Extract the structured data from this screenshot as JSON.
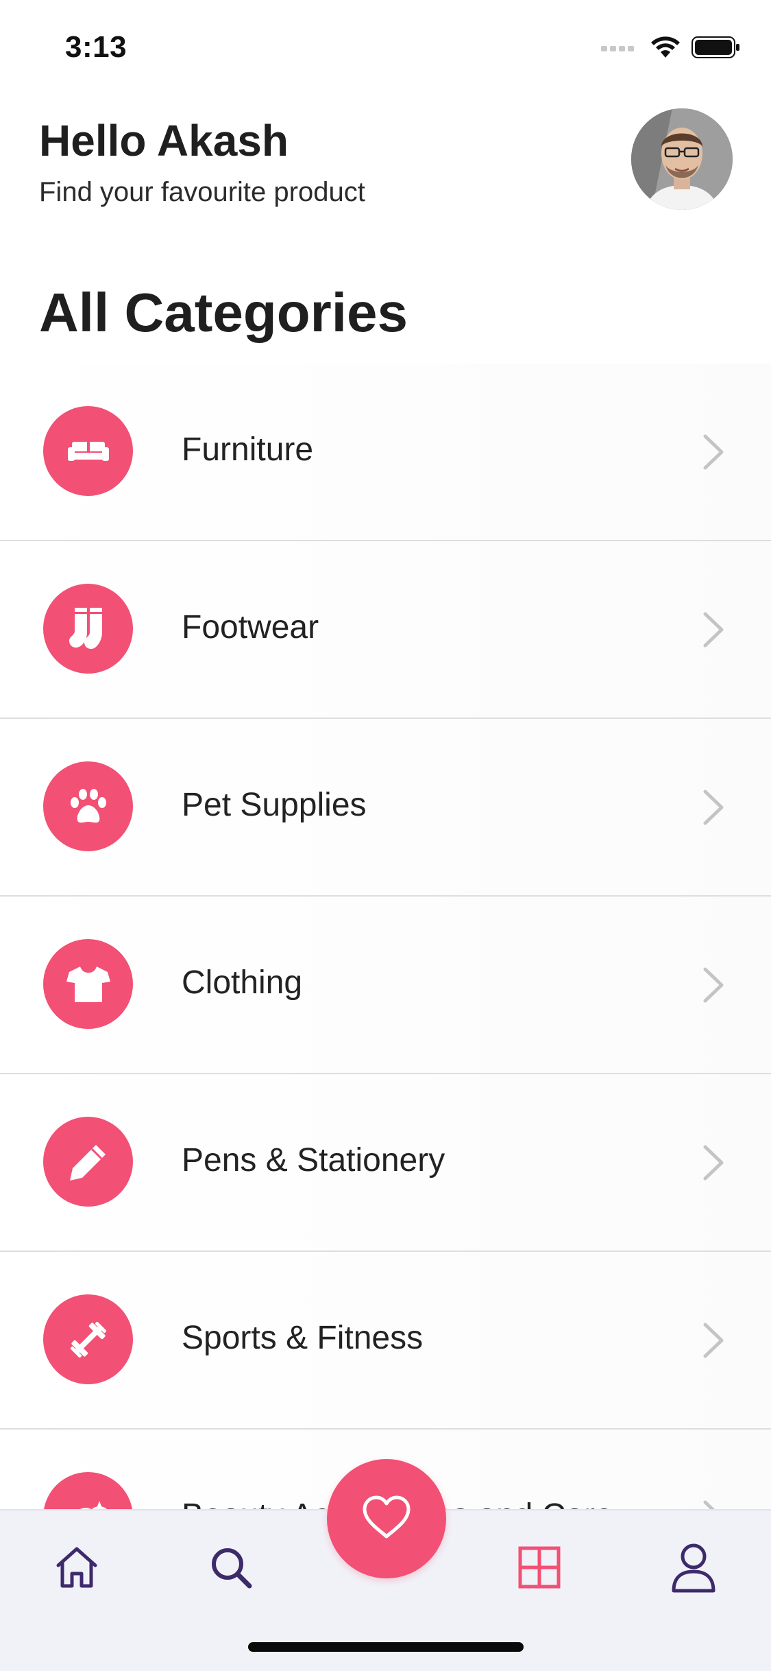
{
  "status_bar": {
    "time": "3:13"
  },
  "header": {
    "greeting": "Hello Akash",
    "subtitle": "Find your favourite product"
  },
  "section_title": "All Categories",
  "categories": [
    {
      "label": "Furniture",
      "icon": "sofa-icon"
    },
    {
      "label": "Footwear",
      "icon": "socks-icon"
    },
    {
      "label": "Pet Supplies",
      "icon": "paw-icon"
    },
    {
      "label": "Clothing",
      "icon": "tshirt-icon"
    },
    {
      "label": "Pens & Stationery",
      "icon": "pencil-icon"
    },
    {
      "label": "Sports & Fitness",
      "icon": "dumbbell-icon"
    },
    {
      "label": "Beauty Accessories and Care",
      "icon": "beauty-icon"
    }
  ],
  "tab_bar": {
    "tabs": [
      {
        "icon": "home-icon"
      },
      {
        "icon": "search-icon"
      },
      {
        "icon": "heart-icon"
      },
      {
        "icon": "grid-icon"
      },
      {
        "icon": "user-icon"
      }
    ]
  },
  "colors": {
    "accent": "#f25074",
    "tab_icon": "#3d2a6b",
    "tab_bar_bg": "#f1f2f8"
  }
}
